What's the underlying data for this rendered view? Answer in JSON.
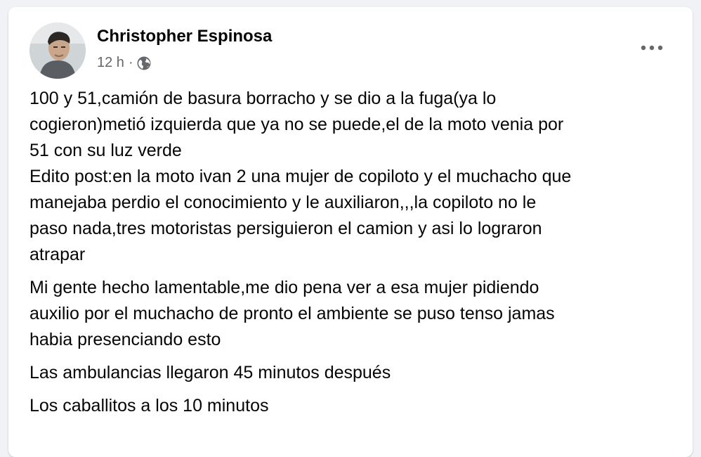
{
  "post": {
    "author": "Christopher Espinosa",
    "time": "12 h",
    "separator": "·",
    "privacy_icon": "globe-icon",
    "more_icon": "more-horizontal-icon",
    "paragraphs": [
      {
        "lines": [
          "100 y 51,camión de basura borracho y se dio a la fuga(ya lo",
          "cogieron)metió izquierda que ya no se puede,el de la moto venia por",
          "51 con su luz verde",
          "Edito post:en la moto ivan 2 una mujer de copiloto y el muchacho que",
          "manejaba perdio el conocimiento y le auxiliaron,,,la copiloto no le",
          "paso nada,tres motoristas persiguieron el camion y asi lo lograron",
          "atrapar"
        ]
      },
      {
        "lines": [
          "Mi gente hecho lamentable,me dio pena ver a esa mujer pidiendo",
          "auxilio por el muchacho de pronto el ambiente se puso tenso jamas",
          "habia presenciando esto"
        ]
      },
      {
        "lines": [
          "Las ambulancias llegaron 45 minutos después"
        ]
      },
      {
        "lines": [
          "Los caballitos a los 10 minutos"
        ]
      }
    ]
  },
  "colors": {
    "background": "#f0f2f5",
    "card": "#ffffff",
    "text": "#050505",
    "secondary": "#65676b"
  }
}
